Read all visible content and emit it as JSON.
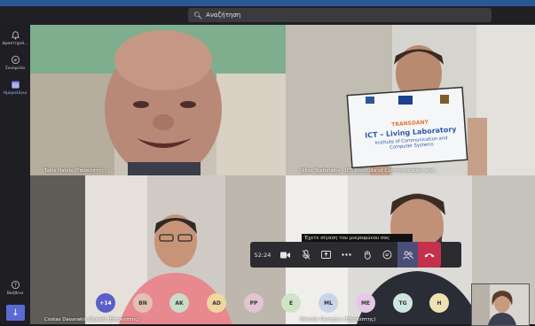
{
  "app": {
    "search_placeholder": "Αναζήτηση"
  },
  "rail": {
    "items": [
      {
        "label": "Δραστηριό..."
      },
      {
        "label": "Συνομιλία"
      },
      {
        "label": "Ημερολόγιο"
      },
      {
        "label": "Βοήθεια"
      }
    ]
  },
  "tiles": [
    {
      "name": "Takis Hatzis (Επισκέπτης)"
    },
    {
      "name": "Nikos Stefanakis - ICS (Institute of Communication and..."
    },
    {
      "name": "Costas Davarakis (Guest) (Επισκέπτης)"
    },
    {
      "name": "Manolis Georgiou (Επισκέπτης)"
    }
  ],
  "sign": {
    "brand": "TRANSDANY",
    "title": "ICT – Living Laboratory",
    "subtitle1": "Institute of Communication and",
    "subtitle2": "Computer Systems"
  },
  "controls": {
    "time": "52:24",
    "tooltip": "Έχετε σίγαση του μικροφώνου σας"
  },
  "participants": {
    "more": "+14",
    "initials": [
      "BN",
      "AK",
      "AD",
      "PP",
      "E",
      "ML",
      "ME",
      "TG",
      "H"
    ],
    "colors": [
      "#e3c0b3",
      "#c9dcc7",
      "#f0d7a0",
      "#e2c4d2",
      "#cfe3c6",
      "#c8d4ea",
      "#e6c8e6",
      "#cfe6e0",
      "#f0e1b5"
    ]
  }
}
